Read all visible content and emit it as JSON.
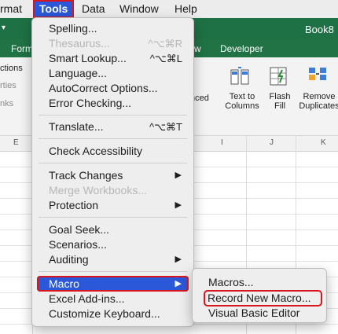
{
  "menubar": {
    "format": "rmat",
    "tools": "Tools",
    "data": "Data",
    "window": "Window",
    "help": "Help"
  },
  "ribbon": {
    "book_title": "Book8",
    "tabs": {
      "formulas_partial": "Form",
      "view_partial": "w",
      "developer": "Developer"
    },
    "left_labels": [
      "ctions",
      "rties",
      "nks"
    ],
    "advanced_partial": "nced",
    "buttons": [
      {
        "label": "Text to\nColumns",
        "icon": "text-to-columns-icon"
      },
      {
        "label": "Flash\nFill",
        "icon": "flash-fill-icon"
      },
      {
        "label": "Remove\nDuplicates",
        "icon": "remove-duplicates-icon"
      }
    ]
  },
  "sheet": {
    "columns": [
      "E",
      "I",
      "J",
      "K"
    ]
  },
  "tools_menu": {
    "items": [
      {
        "label": "Spelling...",
        "shortcut": "",
        "enabled": true
      },
      {
        "label": "Thesaurus...",
        "shortcut": "^⌥⌘R",
        "enabled": false
      },
      {
        "label": "Smart Lookup...",
        "shortcut": "^⌥⌘L",
        "enabled": true
      },
      {
        "label": "Language...",
        "shortcut": "",
        "enabled": true
      },
      {
        "label": "AutoCorrect Options...",
        "shortcut": "",
        "enabled": true
      },
      {
        "label": "Error Checking...",
        "shortcut": "",
        "enabled": true
      },
      {
        "label": "Translate...",
        "shortcut": "^⌥⌘T",
        "enabled": true
      },
      {
        "label": "Check Accessibility",
        "shortcut": "",
        "enabled": true
      },
      {
        "label": "Track Changes",
        "shortcut": "▶",
        "enabled": true
      },
      {
        "label": "Merge Workbooks...",
        "shortcut": "",
        "enabled": false
      },
      {
        "label": "Protection",
        "shortcut": "▶",
        "enabled": true
      },
      {
        "label": "Goal Seek...",
        "shortcut": "",
        "enabled": true
      },
      {
        "label": "Scenarios...",
        "shortcut": "",
        "enabled": true
      },
      {
        "label": "Auditing",
        "shortcut": "▶",
        "enabled": true
      },
      {
        "label": "Macro",
        "shortcut": "▶",
        "enabled": true,
        "highlighted": true
      },
      {
        "label": "Excel Add-ins...",
        "shortcut": "",
        "enabled": true
      },
      {
        "label": "Customize Keyboard...",
        "shortcut": "",
        "enabled": true
      }
    ]
  },
  "macro_submenu": {
    "items": [
      {
        "label": "Macros..."
      },
      {
        "label": "Record New Macro..."
      },
      {
        "label": "Visual Basic Editor"
      }
    ]
  },
  "colors": {
    "excel_green": "#217346",
    "menu_highlight": "#2a58d8",
    "annotation_red": "#d9161d"
  }
}
